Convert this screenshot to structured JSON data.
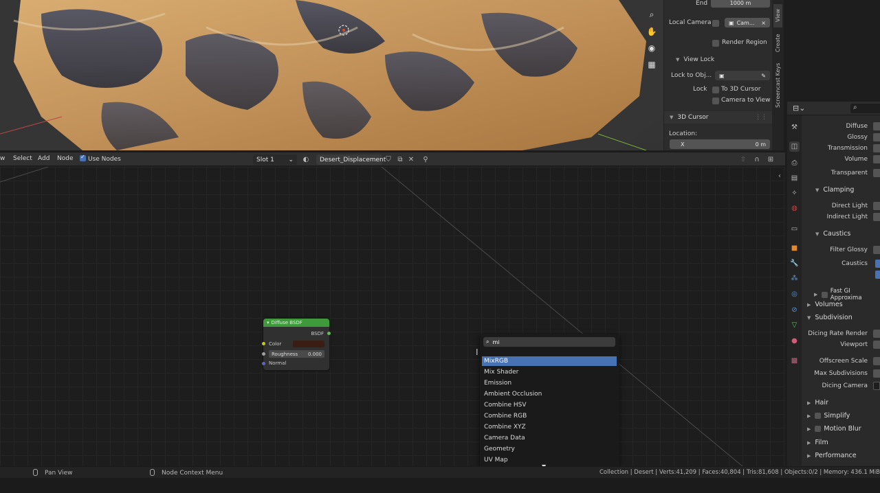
{
  "viewport": {
    "npanel": {
      "end_label": "End",
      "end_value": "1000 m",
      "local_camera_label": "Local Camera",
      "local_camera_value": "Cam...",
      "render_region_label": "Render Region",
      "view_lock_header": "View Lock",
      "lock_to_obj_label": "Lock to Obj...",
      "lock_label": "Lock",
      "to_3d_cursor_label": "To 3D Cursor",
      "camera_to_view_label": "Camera to View",
      "cursor_header": "3D Cursor",
      "location_label": "Location:",
      "x_label": "X",
      "x_value": "0 m"
    },
    "side_tabs": [
      "View",
      "Create",
      "Screencast Keys"
    ]
  },
  "node_header": {
    "view_menu": "w",
    "select_menu": "Select",
    "add_menu": "Add",
    "node_menu": "Node",
    "use_nodes_label": "Use Nodes",
    "slot_value": "Slot 1",
    "material_name": "Desert_Displacement"
  },
  "node": {
    "title": "Diffuse BSDF",
    "output_label": "BSDF",
    "color_label": "Color",
    "color_swatch": "#3a1e14",
    "roughness_label": "Roughness",
    "roughness_value": "0.000",
    "normal_label": "Normal"
  },
  "search_popup": {
    "query": "mi",
    "results": [
      "MixRGB",
      "Mix Shader",
      "Emission",
      "Ambient Occlusion",
      "Combine HSV",
      "Combine RGB",
      "Combine XYZ",
      "Camera Data",
      "Geometry",
      "UV Map"
    ],
    "selected_index": 0
  },
  "properties": {
    "rows": {
      "diffuse": "Diffuse",
      "glossy": "Glossy",
      "transmission": "Transmission",
      "volume": "Volume",
      "transparent": "Transparent",
      "clamping": "Clamping",
      "direct_light": "Direct Light",
      "indirect_light": "Indirect Light",
      "caustics_section": "Caustics",
      "filter_glossy": "Filter Glossy",
      "caustics": "Caustics",
      "fast_gi": "Fast GI Approxima",
      "volumes": "Volumes",
      "subdivision": "Subdivision",
      "dicing_rate_render": "Dicing Rate Render",
      "viewport": "Viewport",
      "offscreen_scale": "Offscreen Scale",
      "max_subdivisions": "Max Subdivisions",
      "dicing_camera": "Dicing Camera",
      "hair": "Hair",
      "simplify": "Simplify",
      "motion_blur": "Motion Blur",
      "film": "Film",
      "performance": "Performance"
    }
  },
  "statusbar": {
    "pan_view": "Pan View",
    "node_context_menu": "Node Context Menu",
    "stats": "Collection | Desert | Verts:41,209 | Faces:40,804 | Tris:81,608 | Objects:0/2 | Memory: 436.1 MiB | V"
  },
  "colors": {
    "accent": "#4772b3",
    "node_header_green": "#3f9a3c",
    "sand": "#c89a62"
  }
}
